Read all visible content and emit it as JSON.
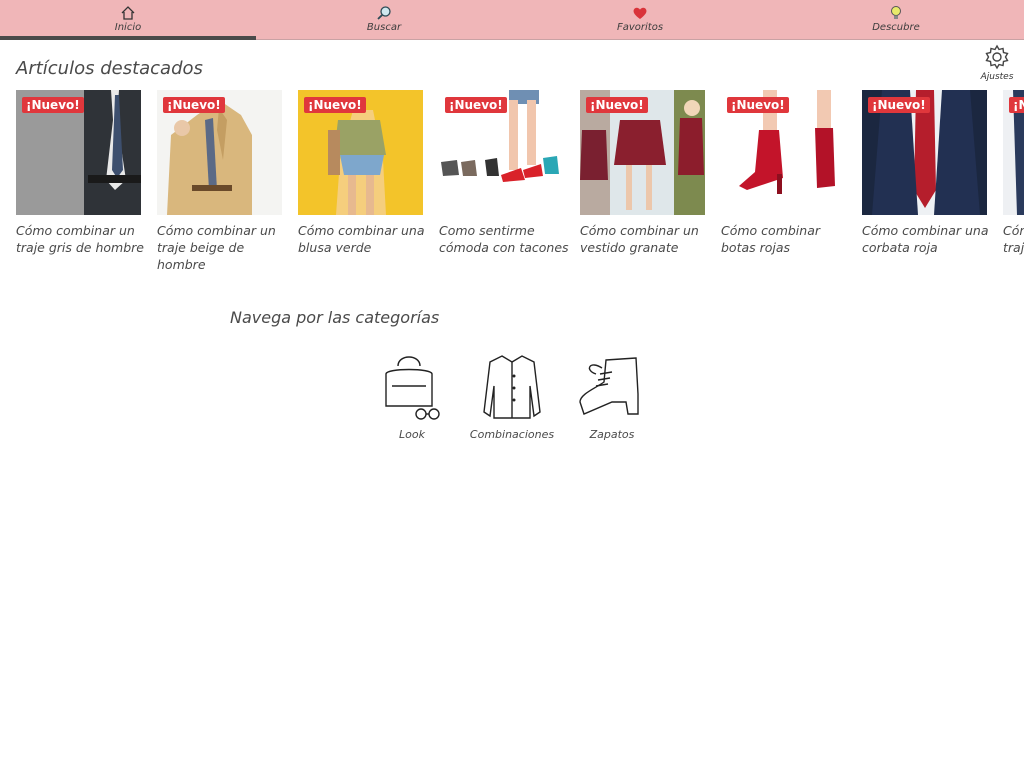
{
  "nav": {
    "tabs": [
      {
        "label": "Inicio",
        "icon": "home-icon",
        "active": true
      },
      {
        "label": "Buscar",
        "icon": "search-icon"
      },
      {
        "label": "Favoritos",
        "icon": "heart-icon"
      },
      {
        "label": "Descubre",
        "icon": "lightbulb-icon"
      }
    ]
  },
  "settings": {
    "label": "Ajustes",
    "icon": "gear-icon"
  },
  "featured": {
    "heading": "Artículos destacados",
    "badge": "¡Nuevo!",
    "articles": [
      {
        "title": "Cómo combinar un traje gris de hombre"
      },
      {
        "title": "Cómo combinar un traje beige de hombre"
      },
      {
        "title": "Cómo combinar una blusa verde"
      },
      {
        "title": "Como sentirme cómoda con tacones"
      },
      {
        "title": "Cómo combinar un vestido granate"
      },
      {
        "title": "Cómo combinar botas rojas"
      },
      {
        "title": "Cómo combinar una corbata roja"
      },
      {
        "title": "Cómo combinar un traje"
      }
    ]
  },
  "categories": {
    "heading": "Navega por las categorías",
    "items": [
      {
        "label": "Look",
        "icon": "handbag-glasses-icon"
      },
      {
        "label": "Combinaciones",
        "icon": "shirt-icon"
      },
      {
        "label": "Zapatos",
        "icon": "boot-icon"
      }
    ]
  },
  "colors": {
    "nav_bg": "#f0b6b8",
    "badge": "#e0373c",
    "active_underline": "#4a4a4a"
  }
}
